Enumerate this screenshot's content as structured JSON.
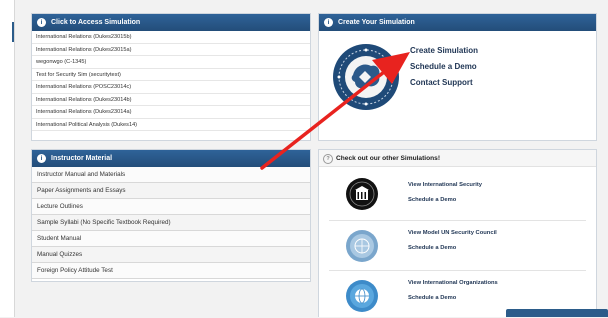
{
  "access_panel": {
    "title": "Click to Access Simulation",
    "items": [
      "International Relations (Dukes23015b)",
      "International Relations (Dukes23015a)",
      "wegonwgo (C-1345)",
      "Test for Security Sim (securitytest)",
      "International Relations (POSC23014c)",
      "International Relations (Dukes23014b)",
      "International Relations (Dukes23014a)",
      "International Political Analysis (Dukes14)"
    ]
  },
  "instructor_panel": {
    "title": "Instructor Material",
    "items": [
      "Instructor Manual and Materials",
      "Paper Assignments and Essays",
      "Lecture Outlines",
      "Sample Syllabi (No Specific Textbook Required)",
      "Student Manual",
      "Manual Quizzes",
      "Foreign Policy Attitude Test"
    ]
  },
  "create_panel": {
    "title": "Create Your Simulation",
    "links": {
      "create": "Create Simulation",
      "demo": "Schedule a Demo",
      "support": "Contact Support"
    }
  },
  "others_panel": {
    "title": "Check out our other Simulations!",
    "items": [
      {
        "view": "View International Security",
        "demo": "Schedule a Demo"
      },
      {
        "view": "View Model UN Security Council",
        "demo": "Schedule a Demo"
      },
      {
        "view": "View International Organizations",
        "demo": "Schedule a Demo"
      }
    ]
  },
  "colors": {
    "header_blue": "#2a5b8c",
    "arrow_red": "#e8231f"
  }
}
